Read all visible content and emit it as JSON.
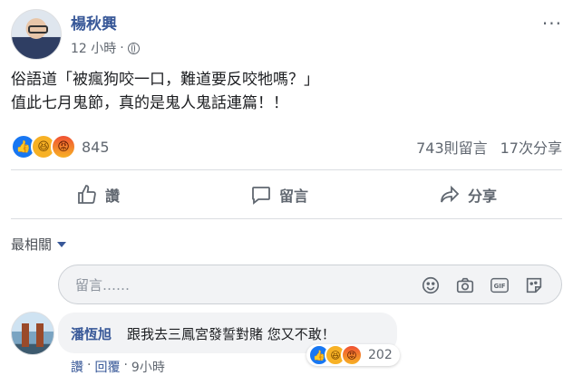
{
  "post": {
    "author": "楊秋興",
    "time": "12 小時",
    "time_sep": "·",
    "line1": "俗語道「被瘋狗咬一口，難道要反咬牠嗎？」",
    "line2": "值此七月鬼節，真的是鬼人鬼話連篇！！",
    "reaction_count": "845",
    "comments_count": "743則留言",
    "shares_count": "17次分享",
    "more_glyph": "···"
  },
  "actions": {
    "like": "讚",
    "comment": "留言",
    "share": "分享"
  },
  "sort": {
    "label": "最相關"
  },
  "composer": {
    "placeholder": "留言……"
  },
  "comment": {
    "name": "潘恆旭",
    "text": "跟我去三鳳宮發誓對賭 您又不敢！",
    "reaction_count": "202",
    "like": "讚",
    "reply": "回覆",
    "time": "9小時",
    "sep": "·"
  },
  "icons": [
    "globe-icon",
    "more-icon",
    "like-icon",
    "comment-icon",
    "share-icon",
    "emoji-icon",
    "camera-icon",
    "gif-icon",
    "sticker-icon"
  ],
  "colors": {
    "link": "#385898",
    "like_blue": "#1877f2",
    "haha": "#f7b125",
    "angry": "#f05133"
  }
}
